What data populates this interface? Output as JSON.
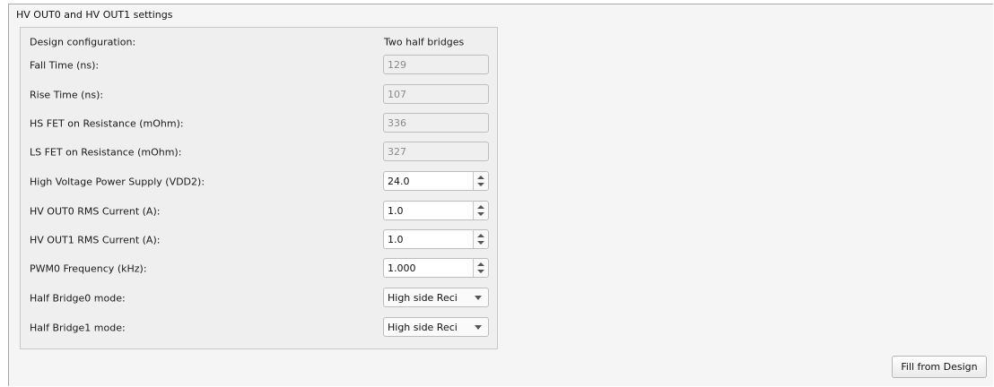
{
  "section": {
    "title": "HV OUT0 and HV OUT1 settings"
  },
  "design_config": {
    "label": "Design configuration:",
    "value": "Two half bridges"
  },
  "fields": [
    {
      "label": "Fall Time (ns):",
      "value": "129",
      "kind": "readonly"
    },
    {
      "label": "Rise Time (ns):",
      "value": "107",
      "kind": "readonly"
    },
    {
      "label": "HS FET on Resistance (mOhm):",
      "value": "336",
      "kind": "readonly"
    },
    {
      "label": "LS FET on Resistance (mOhm):",
      "value": "327",
      "kind": "readonly"
    },
    {
      "label": "High Voltage Power Supply (VDD2):",
      "value": "24.0",
      "kind": "spinner"
    },
    {
      "label": "HV OUT0 RMS Current (A):",
      "value": "1.0",
      "kind": "spinner"
    },
    {
      "label": "HV OUT1 RMS Current (A):",
      "value": "1.0",
      "kind": "spinner"
    },
    {
      "label": "PWM0 Frequency (kHz):",
      "value": "1.000",
      "kind": "spinner"
    },
    {
      "label": "Half Bridge0 mode:",
      "value": "High side Reci",
      "kind": "dropdown"
    },
    {
      "label": "Half Bridge1 mode:",
      "value": "High side Reci",
      "kind": "dropdown"
    }
  ],
  "actions": {
    "fill_label": "Fill from Design"
  }
}
